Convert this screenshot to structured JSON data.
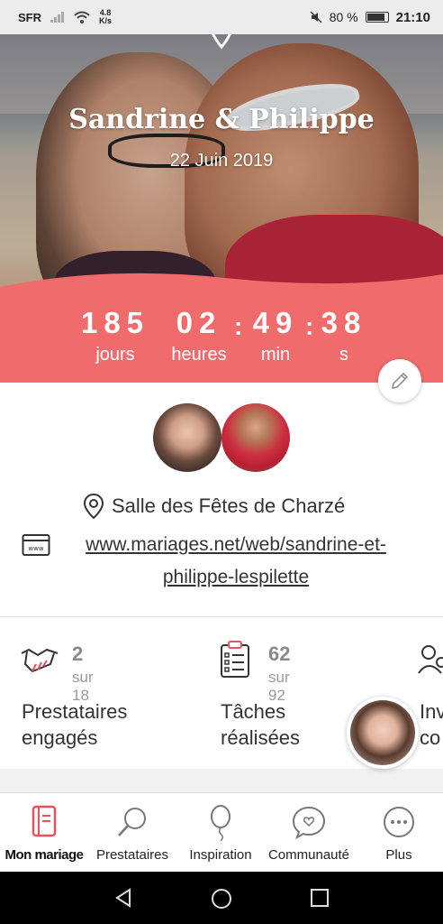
{
  "status_bar": {
    "carrier": "SFR",
    "speed_value": "4.8",
    "speed_unit": "K/s",
    "battery": "80 %",
    "battery_level": 0.8,
    "time": "21:10"
  },
  "hero": {
    "couple": "Sandrine & Philippe",
    "date": "22 Juin 2019"
  },
  "countdown": {
    "days": "185",
    "days_label": "jours",
    "hours": "02",
    "hours_label": "heures",
    "minutes": "49",
    "minutes_label": "min",
    "seconds": "38",
    "seconds_label": "s",
    "separator": ":"
  },
  "wedding": {
    "venue": "Salle des Fêtes de Charzé",
    "website_line1": "www.mariages.net/web/sandrine-et-",
    "website_line2": "philippe-lespilette"
  },
  "stats": [
    {
      "value": "2",
      "total": "sur 18",
      "label_line1": "Prestataires",
      "label_line2": "engagés",
      "icon": "handshake-icon"
    },
    {
      "value": "62",
      "total": "sur 92",
      "label_line1": "Tâches",
      "label_line2": "réalisées",
      "icon": "checklist-icon"
    },
    {
      "label_line1": "Inv",
      "label_line2": "co",
      "icon": "guests-icon"
    }
  ],
  "bottom_nav": [
    {
      "label": "Mon mariage",
      "icon": "notebook-icon",
      "active": true
    },
    {
      "label": "Prestataires",
      "icon": "magnifier-icon"
    },
    {
      "label": "Inspiration",
      "icon": "balloon-icon"
    },
    {
      "label": "Communauté",
      "icon": "chat-heart-icon"
    },
    {
      "label": "Plus",
      "icon": "more-icon"
    }
  ],
  "colors": {
    "accent": "#f06b6b",
    "accent_dark": "#e85a5f",
    "active_icon": "#e8525a"
  }
}
